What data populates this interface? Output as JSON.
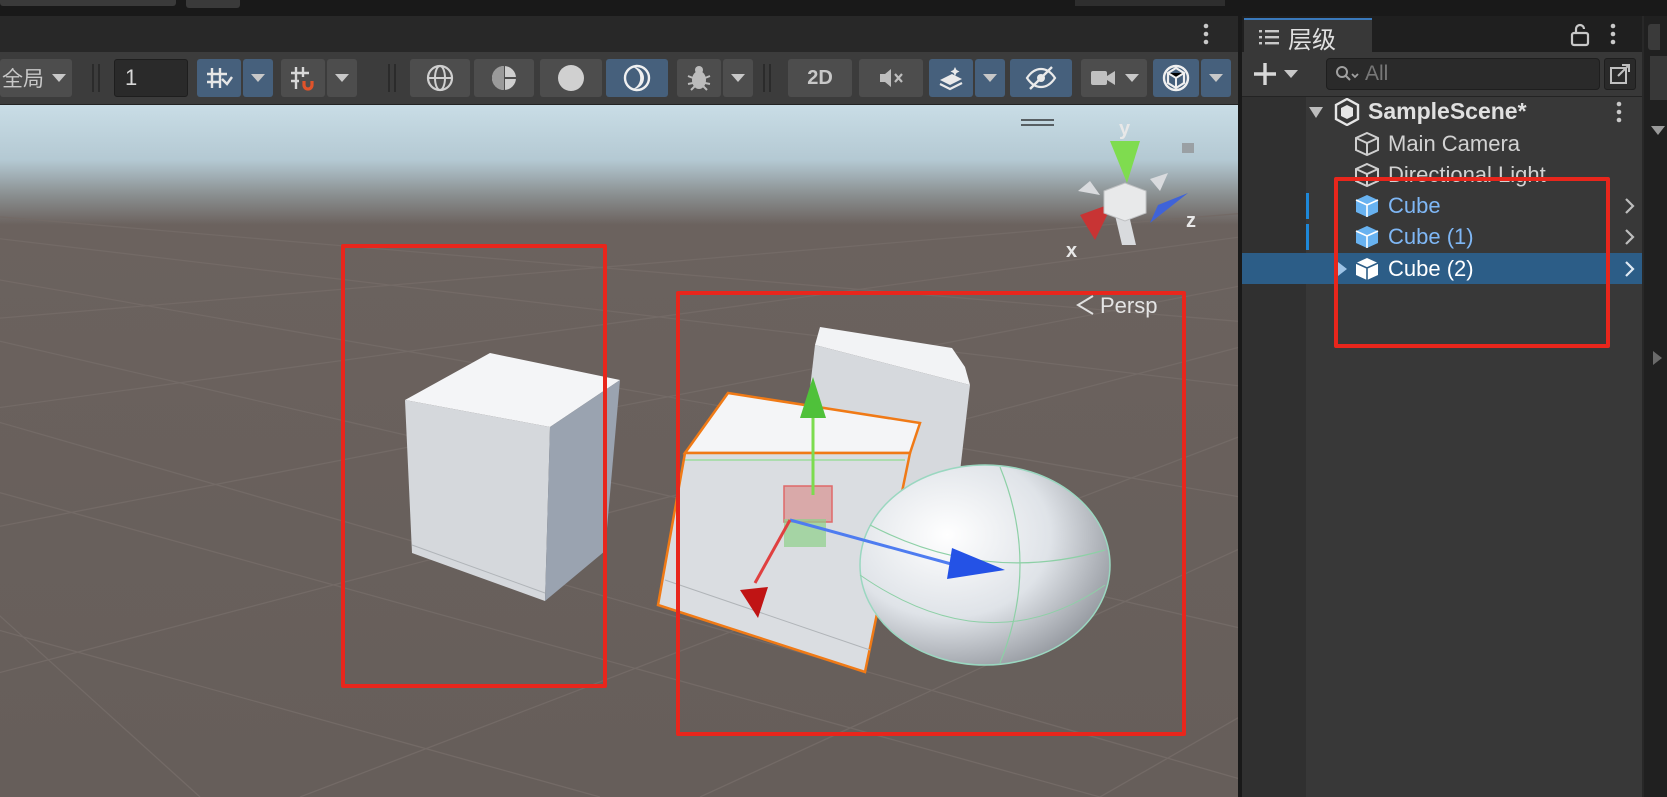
{
  "scene_toolbar": {
    "global_label": "全局",
    "grid_value": "1",
    "mode_2d": "2D"
  },
  "viewport": {
    "projection_label": "Persp",
    "gizmo_axes": {
      "x": "x",
      "y": "y",
      "z": "z"
    }
  },
  "hierarchy": {
    "tab_title": "层级",
    "search_placeholder": "All",
    "scene_name": "SampleScene*",
    "items": [
      {
        "label": "Main Camera",
        "type": "gameobject",
        "selected": false
      },
      {
        "label": "Directional Light",
        "type": "gameobject",
        "selected": false
      },
      {
        "label": "Cube",
        "type": "prefab",
        "selected": false
      },
      {
        "label": "Cube (1)",
        "type": "prefab",
        "selected": false
      },
      {
        "label": "Cube (2)",
        "type": "prefab",
        "selected": true
      }
    ]
  },
  "colors": {
    "selection_blue": "#2c5d87",
    "prefab_blue": "#7fb7f5",
    "annotation_red": "#e8261c",
    "toolbar_active": "#46607c"
  },
  "icons": [
    "more-vert-icon",
    "dropdown-caret-icon",
    "grid-snap-icon",
    "increment-snap-icon",
    "wireframe-shading-icon",
    "shaded-wireframe-icon",
    "shaded-icon",
    "lighting-icon",
    "debug-icon",
    "audio-mute-icon",
    "effects-icon",
    "visibility-icon",
    "camera-icon",
    "gizmos-icon",
    "hierarchy-list-icon",
    "lock-icon",
    "plus-icon",
    "search-icon",
    "scene-icon",
    "gameobject-cube-icon",
    "prefab-cube-icon",
    "chevron-right-icon",
    "expand-arrow-icon"
  ]
}
